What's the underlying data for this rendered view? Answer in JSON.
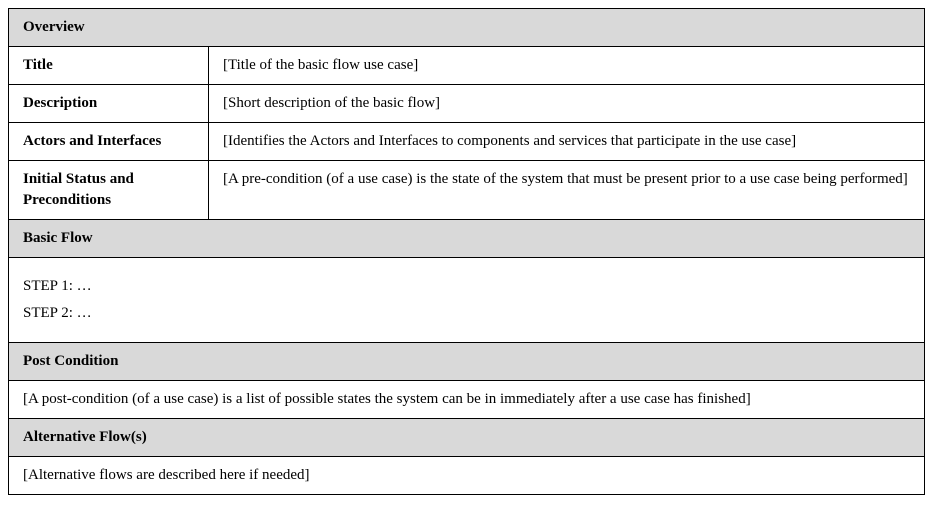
{
  "overview": {
    "header": "Overview",
    "title": {
      "label": "Title",
      "value": "[Title of the basic flow use case]"
    },
    "description": {
      "label": "Description",
      "value": "[Short description of the basic flow]"
    },
    "actors": {
      "label": "Actors and Interfaces",
      "value": "[Identifies the Actors and Interfaces to components and services that participate in the use case]"
    },
    "preconditions": {
      "label": "Initial Status and Preconditions",
      "value": "[A pre-condition (of a use case) is the state of the system that must be present prior to a use case being performed]"
    }
  },
  "basicFlow": {
    "header": "Basic Flow",
    "steps": [
      "STEP 1: …",
      "STEP 2: …"
    ]
  },
  "postCondition": {
    "header": "Post Condition",
    "value": "[A post-condition (of a use case) is a list of possible states the system can be in immediately after a use case has finished]"
  },
  "alternativeFlows": {
    "header": "Alternative Flow(s)",
    "value": "[Alternative flows are described here if needed]"
  }
}
